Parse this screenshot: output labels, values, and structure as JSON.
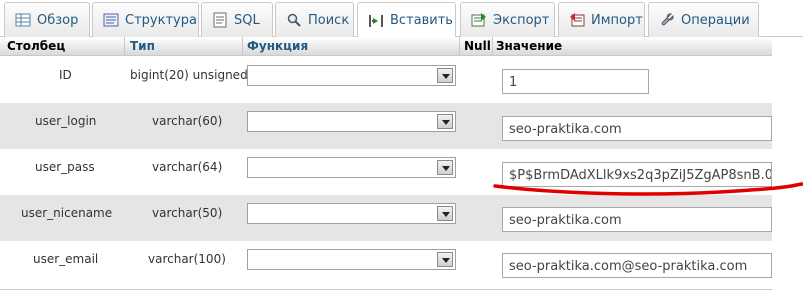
{
  "tabs": [
    {
      "label": "Обзор",
      "icon": "browse-icon",
      "active": false
    },
    {
      "label": "Структура",
      "icon": "structure-icon",
      "active": false
    },
    {
      "label": "SQL",
      "icon": "sql-icon",
      "active": false
    },
    {
      "label": "Поиск",
      "icon": "search-icon",
      "active": false
    },
    {
      "label": "Вставить",
      "icon": "insert-icon",
      "active": true
    },
    {
      "label": "Экспорт",
      "icon": "export-icon",
      "active": false
    },
    {
      "label": "Импорт",
      "icon": "import-icon",
      "active": false
    },
    {
      "label": "Операции",
      "icon": "operations-icon",
      "active": false
    }
  ],
  "header": {
    "column": "Столбец",
    "type": "Тип",
    "function": "Функция",
    "null": "Null",
    "value": "Значение"
  },
  "rows": [
    {
      "name": "ID",
      "type": "bigint(20) unsigned",
      "function": "",
      "value": "1"
    },
    {
      "name": "user_login",
      "type": "varchar(60)",
      "function": "",
      "value": "seo-praktika.com"
    },
    {
      "name": "user_pass",
      "type": "varchar(64)",
      "function": "",
      "value": "$P$BrmDAdXLlk9xs2q3pZiJ5ZgAP8snB.0"
    },
    {
      "name": "user_nicename",
      "type": "varchar(50)",
      "function": "",
      "value": "seo-praktika.com"
    },
    {
      "name": "user_email",
      "type": "varchar(100)",
      "function": "",
      "value": "seo-praktika.com@seo-praktika.com"
    }
  ],
  "colors": {
    "link": "#235a81",
    "row_alt": "#e5e5e5",
    "annotation": "#e00000"
  }
}
